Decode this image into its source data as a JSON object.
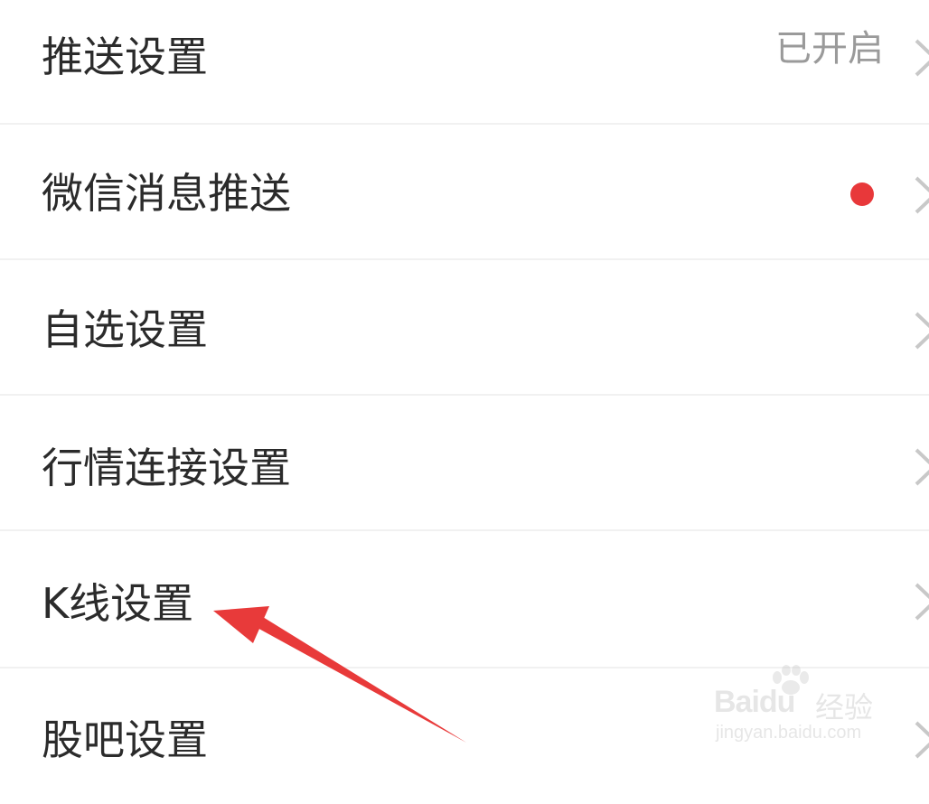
{
  "settings": {
    "items": [
      {
        "label": "推送设置",
        "status": "已开启"
      },
      {
        "label": "微信消息推送",
        "badge": "red-dot"
      },
      {
        "label": "自选设置"
      },
      {
        "label": "行情连接设置"
      },
      {
        "label": "K线设置"
      },
      {
        "label": "股吧设置"
      }
    ]
  },
  "watermark": {
    "brand": "Baidu",
    "product": "经验",
    "url": "jingyan.baidu.com"
  },
  "colors": {
    "badge_red": "#e8383a",
    "annotation_arrow": "#e83a3a",
    "label_text": "#2b2b2b",
    "status_text": "#9a9a9a",
    "chevron": "#c8c8c8"
  },
  "icons": {
    "chevron": "chevron-right-icon",
    "badge": "red-dot-badge",
    "annotation": "red-arrow"
  }
}
